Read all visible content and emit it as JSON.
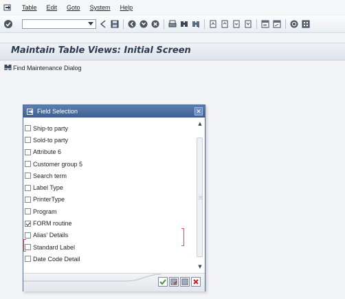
{
  "menu": {
    "items": [
      "Table",
      "Edit",
      "Goto",
      "System",
      "Help"
    ]
  },
  "toolbar": {
    "command_value": "",
    "icons": [
      "enter-icon",
      "dropdown-icon",
      "back-history-icon",
      "save-icon",
      "back-icon",
      "exit-icon",
      "cancel-icon",
      "print-icon",
      "find-icon",
      "find-next-icon",
      "first-page-icon",
      "previous-page-icon",
      "next-page-icon",
      "last-page-icon",
      "create-session-icon",
      "shortcut-icon",
      "help-icon",
      "layout-icon"
    ]
  },
  "page": {
    "title": "Maintain Table Views: Initial Screen"
  },
  "app_toolbar": {
    "find_dialog_label": "Find Maintenance Dialog"
  },
  "dialog": {
    "title": "Field Selection",
    "fields": [
      {
        "label": "Ship-to party",
        "checked": false
      },
      {
        "label": "Sold-to party",
        "checked": false
      },
      {
        "label": "Attribute 6",
        "checked": false
      },
      {
        "label": "Customer group 5",
        "checked": false
      },
      {
        "label": "Search term",
        "checked": false
      },
      {
        "label": "Label Type",
        "checked": false
      },
      {
        "label": "PrinterType",
        "checked": false
      },
      {
        "label": "Program",
        "checked": false
      },
      {
        "label": "FORM routine",
        "checked": true
      },
      {
        "label": "Alias' Details",
        "checked": false
      },
      {
        "label": "Standard Label",
        "checked": false
      },
      {
        "label": "Date Code Detail",
        "checked": false
      }
    ],
    "footer_buttons": [
      "continue-icon",
      "select-all-icon",
      "deselect-all-icon",
      "cancel-icon"
    ]
  },
  "colors": {
    "dialog_header": "#3d5f91",
    "title_text": "#2b3a4d",
    "focus_marker": "#e05050",
    "cancel_red": "#d11a1a",
    "continue_green": "#3a9a2a"
  }
}
